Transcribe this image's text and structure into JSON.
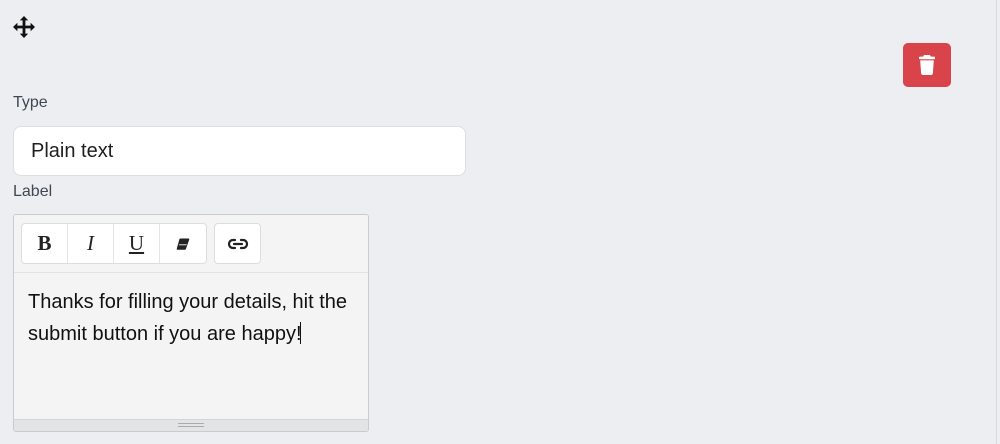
{
  "icons": {
    "move": "move-icon",
    "delete": "trash-icon",
    "eraser": "eraser-icon",
    "link": "link-icon"
  },
  "colors": {
    "background": "#edeef1",
    "delete_button": "#d9434a",
    "input_background": "#ffffff"
  },
  "form": {
    "type_label": "Type",
    "type_value": "Plain text",
    "label_label": "Label"
  },
  "editor": {
    "toolbar": {
      "bold": "B",
      "italic": "I",
      "underline": "U"
    },
    "content": "Thanks for filling your details, hit the submit button if you are happy!"
  }
}
